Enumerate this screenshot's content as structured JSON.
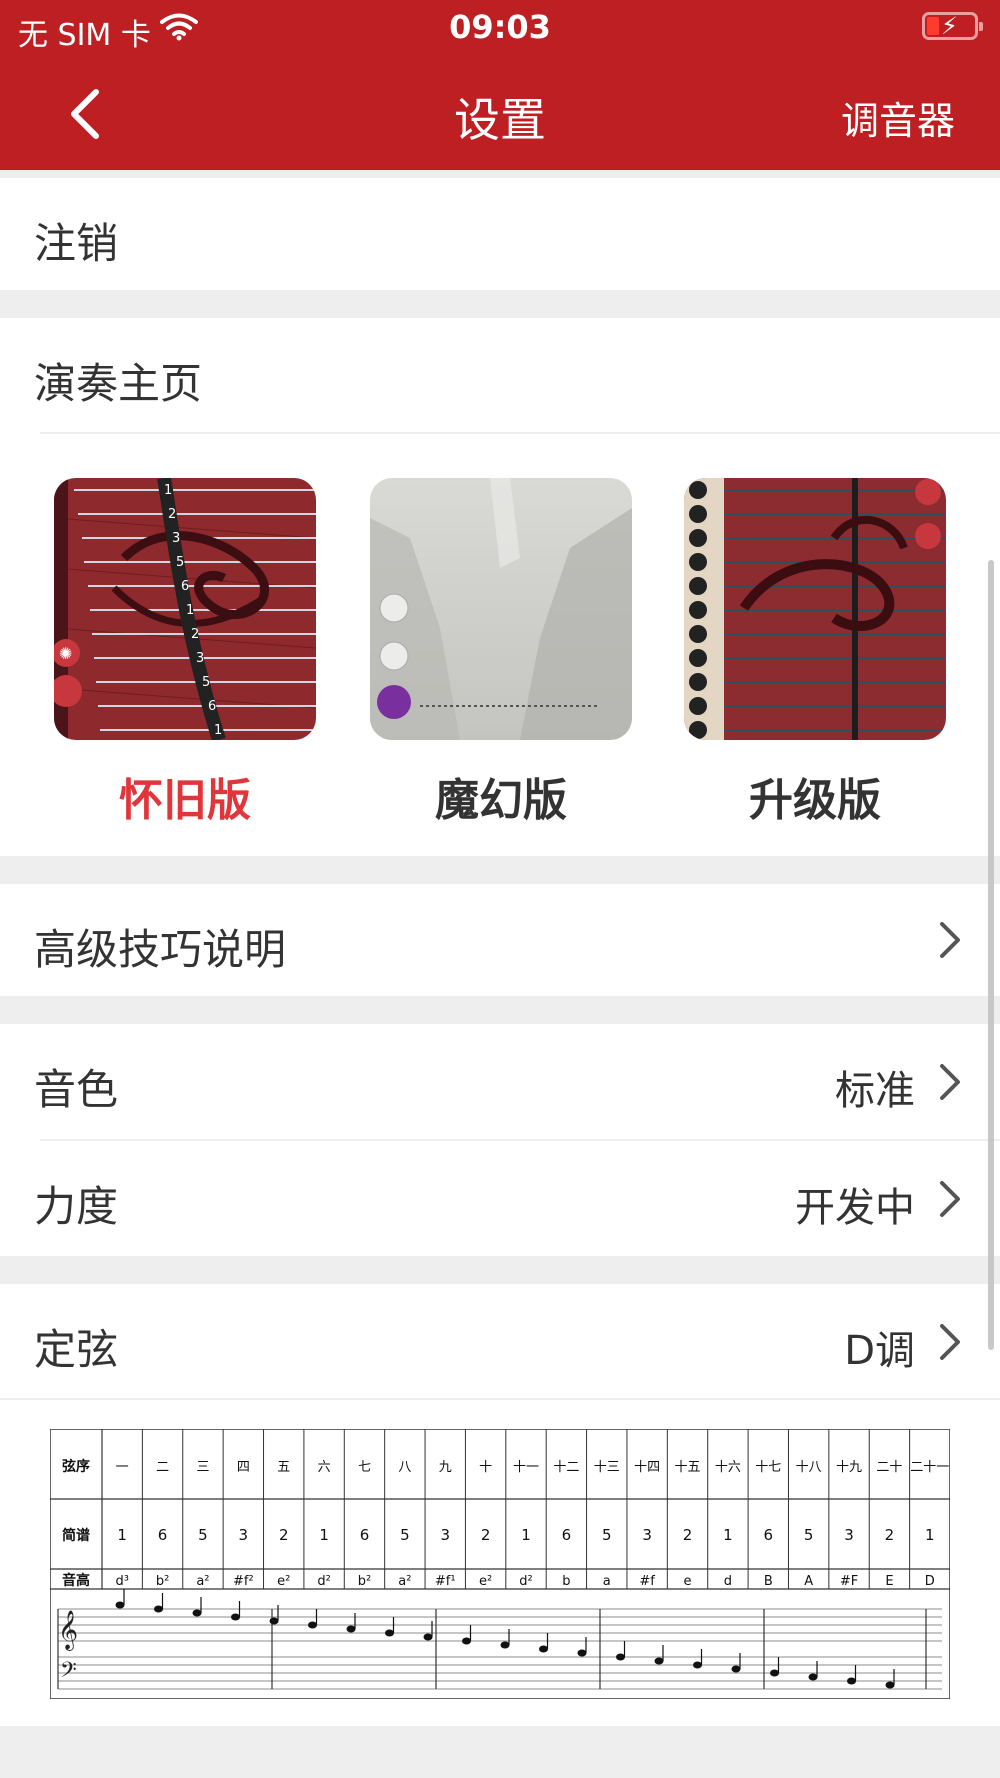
{
  "status_bar": {
    "carrier": "无 SIM 卡",
    "time": "09:03"
  },
  "nav": {
    "title": "设置",
    "tuner_label": "调音器"
  },
  "rows": {
    "logout": "注销",
    "play_home": "演奏主页",
    "advanced": "高级技巧说明",
    "timbre": {
      "label": "音色",
      "value": "标准"
    },
    "force": {
      "label": "力度",
      "value": "开发中"
    },
    "tuning": {
      "label": "定弦",
      "value": "D调"
    }
  },
  "themes": [
    {
      "label": "怀旧版",
      "selected": true
    },
    {
      "label": "魔幻版",
      "selected": false
    },
    {
      "label": "升级版",
      "selected": false
    }
  ],
  "string_table": {
    "headers": [
      "弦序",
      "简谱",
      "音高"
    ],
    "numbers": [
      "一",
      "二",
      "三",
      "四",
      "五",
      "六",
      "七",
      "八",
      "九",
      "十",
      "十一",
      "十二",
      "十三",
      "十四",
      "十五",
      "十六",
      "十七",
      "十八",
      "十九",
      "二十",
      "二十一"
    ],
    "jianpu": [
      "1",
      "6",
      "5",
      "3",
      "2",
      "1",
      "6",
      "5",
      "3",
      "2",
      "1",
      "6",
      "5",
      "3",
      "2",
      "1",
      "6",
      "5",
      "3",
      "2",
      "1"
    ],
    "pitch": [
      "d³",
      "b²",
      "a²",
      "#f²",
      "e²",
      "d²",
      "b²",
      "a²",
      "#f¹",
      "e²",
      "d²",
      "b",
      "a",
      "#f",
      "e",
      "d",
      "B",
      "A",
      "#F",
      "E",
      "D"
    ]
  },
  "colors": {
    "brand_red": "#bd1f22",
    "selected_red": "#e0353b",
    "text": "#333333"
  }
}
